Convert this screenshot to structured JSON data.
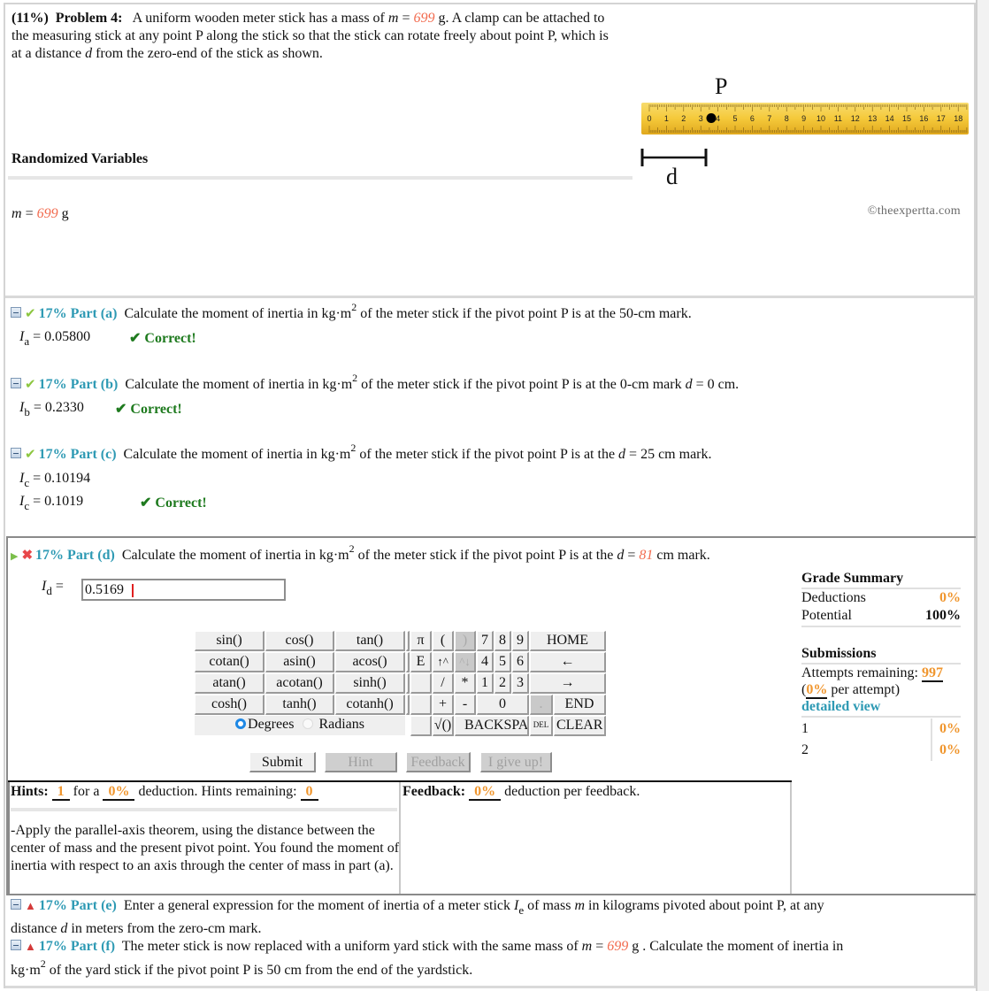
{
  "problem": {
    "weight": "(11%)",
    "label": "Problem 4:",
    "text_1": "A uniform wooden meter stick has a mass of",
    "var_m": "m",
    "eq": " = ",
    "mass_value": "699",
    "mass_unit": "g",
    "text_2": ". A clamp can be attached to the measuring stick at any point P along the stick so that the stick can rotate freely about point P, which is at a distance",
    "var_d": "d",
    "text_3": "from the zero-end of the stick as shown."
  },
  "randomized": {
    "title": "Randomized Variables",
    "var": "m",
    "eq": " = ",
    "value": "699",
    "unit": "g"
  },
  "figure": {
    "point_label": "P",
    "distance_label": "d",
    "ruler_numbers": [
      "0",
      "1",
      "2",
      "3",
      "4",
      "5",
      "6",
      "7",
      "8",
      "9",
      "10",
      "11",
      "12",
      "13",
      "14",
      "15",
      "16",
      "17",
      "18"
    ],
    "copyright": "©theexpertta.com"
  },
  "parts": [
    {
      "status": "correct",
      "weight": "17%",
      "label": "Part (a)",
      "text_pre": "Calculate the moment of inertia in kg·m",
      "text_post": " of the meter stick if the pivot point P is at the 50-cm mark.",
      "answers": [
        {
          "var": "I",
          "sub": "a",
          "value": " = 0.05800",
          "result": "✔ Correct!"
        }
      ]
    },
    {
      "status": "correct",
      "weight": "17%",
      "label": "Part (b)",
      "text_pre": "Calculate the moment of inertia in kg·m",
      "text_post": " of the meter stick if the pivot point P is at the 0-cm mark ",
      "text_var": "d",
      "text_tail": " = 0 cm.",
      "answers": [
        {
          "var": "I",
          "sub": "b",
          "value": " = 0.2330",
          "result": "✔ Correct!"
        }
      ]
    },
    {
      "status": "correct",
      "weight": "17%",
      "label": "Part (c)",
      "text_pre": "Calculate the moment of inertia in kg·m",
      "text_post": " of the meter stick if the pivot point P is at the ",
      "text_var": "d",
      "text_tail": " = 25 cm mark.",
      "answers": [
        {
          "var": "I",
          "sub": "c",
          "value": " = 0.10194",
          "result": ""
        },
        {
          "var": "I",
          "sub": "c",
          "value": " = 0.1019",
          "result": "✔ Correct!"
        }
      ]
    },
    {
      "status": "incorrect",
      "weight": "17%",
      "label": "Part (d)",
      "text_pre": "Calculate the moment of inertia in kg·m",
      "text_post": " of the meter stick if the pivot point P is at the ",
      "text_var": "d",
      "text_eq": " = ",
      "d_value": "81",
      "text_tail": " cm mark.",
      "input_var": "I",
      "input_sub": "d",
      "input_eq": " =",
      "input_value": "0.5169"
    },
    {
      "status": "locked",
      "weight": "17%",
      "label": "Part (e)",
      "text_1": "Enter a general expression for the moment of inertia of a meter stick ",
      "var_I": "I",
      "sub": "e",
      "text_2": " of mass ",
      "var_m": "m",
      "text_3": " in kilograms pivoted about point P, at any",
      "text_4": "distance ",
      "var_d": "d",
      "text_5": " in meters from the zero-cm mark."
    },
    {
      "status": "locked",
      "weight": "17%",
      "label": "Part (f)",
      "text_1": "The meter stick is now replaced with a uniform yard stick with the same mass of ",
      "var_m": "m",
      "eq": " = ",
      "mass_value": "699",
      "text_2": " g . Calculate the moment of inertia in",
      "text_3": "kg·m",
      "text_4": " of the yard stick if the pivot point P is 50 cm from the end of the yardstick."
    }
  ],
  "keypad": {
    "functions": [
      [
        "sin()",
        "cos()",
        "tan()"
      ],
      [
        "cotan()",
        "asin()",
        "acos()"
      ],
      [
        "atan()",
        "acotan()",
        "sinh()"
      ],
      [
        "cosh()",
        "tanh()",
        "cotanh()"
      ]
    ],
    "angle_modes": {
      "selected": "Degrees",
      "other": "Radians"
    },
    "keys": {
      "pi": "π",
      "lparen": "(",
      "rparen": ")",
      "7": "7",
      "8": "8",
      "9": "9",
      "home": "HOME",
      "e": "E",
      "up": "↑^",
      "down": "^↓",
      "4": "4",
      "5": "5",
      "6": "6",
      "left": "←",
      "div": "/",
      "mul": "*",
      "1": "1",
      "2": "2",
      "3": "3",
      "right": "→",
      "plus": "+",
      "minus": "-",
      "0": "0",
      "dot": ".",
      "end": "END",
      "sqrt": "√()",
      "backspace": "BACKSPACE",
      "del": "DEL",
      "clear": "CLEAR"
    }
  },
  "actions": {
    "submit": "Submit",
    "hint": "Hint",
    "feedback": "Feedback",
    "give_up": "I give up!"
  },
  "hints": {
    "label": "Hints:",
    "count": "1",
    "text_1": "for a",
    "deduction": "0%",
    "text_2": "deduction. Hints remaining:",
    "remaining": "0",
    "hint_text": "-Apply the parallel-axis theorem, using the distance between the center of mass and the present pivot point. You found the moment of inertia with respect to an axis through the center of mass in part (a)."
  },
  "feedback": {
    "label": "Feedback:",
    "deduction": "0%",
    "text": "deduction per feedback."
  },
  "grade_summary": {
    "title": "Grade Summary",
    "deductions_label": "Deductions",
    "deductions_value": "0%",
    "potential_label": "Potential",
    "potential_value": "100%"
  },
  "submissions": {
    "title": "Submissions",
    "attempts_label": "Attempts remaining:",
    "attempts_value": "997",
    "per_attempt_open": "(",
    "per_attempt_value": "0%",
    "per_attempt_text": " per attempt)",
    "detailed_view": "detailed view",
    "rows": [
      {
        "n": "1",
        "value": "0%"
      },
      {
        "n": "2",
        "value": "0%"
      }
    ]
  },
  "colors": {
    "random_value": "#f26b4f",
    "part_label": "#2e9ab4",
    "correct": "#1e7a1e",
    "orange": "#f0962e"
  }
}
